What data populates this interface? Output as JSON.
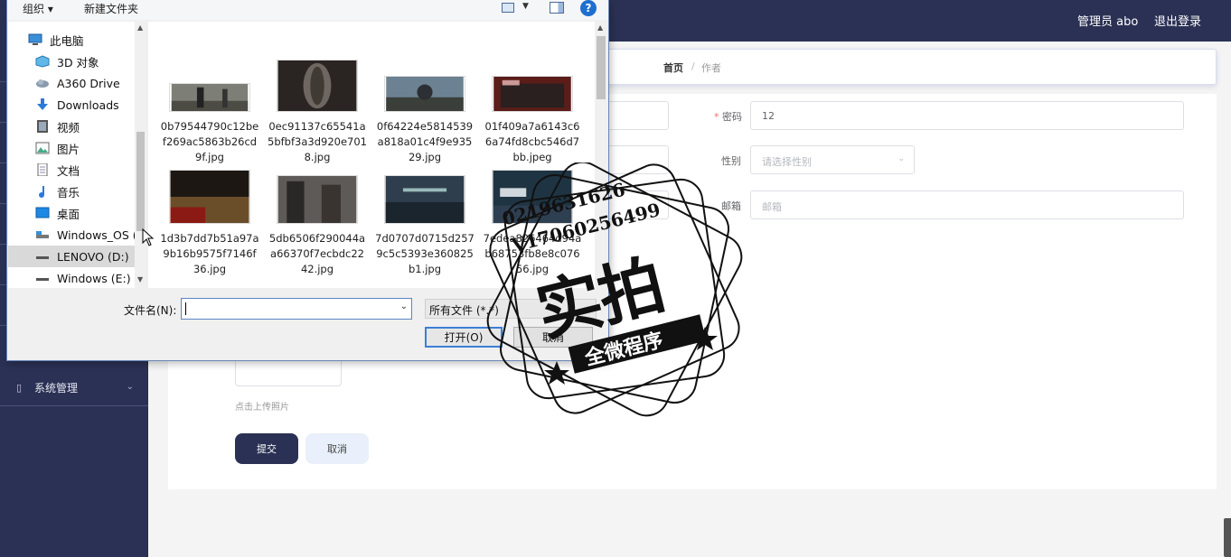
{
  "topbar": {
    "user": "管理员 abo",
    "logout": "退出登录"
  },
  "breadcrumb": {
    "home": "首页",
    "separator": "/",
    "current": "作者"
  },
  "sidebar": {
    "items": [
      {
        "label": "系统管理",
        "icon": "phone-icon"
      }
    ]
  },
  "form": {
    "password": {
      "label": "密码",
      "required_mark": "*",
      "value": "12"
    },
    "gender": {
      "label": "性别",
      "placeholder": "请选择性别"
    },
    "email": {
      "label": "邮箱",
      "placeholder": "邮箱"
    },
    "upload_hint": "点击上传照片",
    "submit": "提交",
    "cancel": "取消"
  },
  "dialog": {
    "toolbar": {
      "organize": "组织 ▾",
      "new_folder": "新建文件夹",
      "help": "?"
    },
    "nav_items": [
      {
        "label": "此电脑",
        "icon": "computer-icon"
      },
      {
        "label": "3D 对象",
        "icon": "cube-icon"
      },
      {
        "label": "A360 Drive",
        "icon": "cloud-drive-icon"
      },
      {
        "label": "Downloads",
        "icon": "download-arrow-icon"
      },
      {
        "label": "视频",
        "icon": "film-icon"
      },
      {
        "label": "图片",
        "icon": "picture-icon"
      },
      {
        "label": "文档",
        "icon": "document-icon"
      },
      {
        "label": "音乐",
        "icon": "music-note-icon"
      },
      {
        "label": "桌面",
        "icon": "desktop-icon"
      },
      {
        "label": "Windows_OS (C",
        "icon": "drive-icon"
      },
      {
        "label": "LENOVO (D:)",
        "icon": "drive-icon",
        "selected": true
      },
      {
        "label": "Windows (E:)",
        "icon": "drive-icon"
      }
    ],
    "files": [
      {
        "name": "0b79544790c12bef269ac5863b26cd9f.jpg"
      },
      {
        "name": "0ec91137c65541a5bfbf3a3d920e7018.jpg"
      },
      {
        "name": "0f64224e5814539a818a01c4f9e93529.jpg"
      },
      {
        "name": "01f409a7a6143c66a74fd8cbc546d7bb.jpeg"
      },
      {
        "name": "1d3b7dd7b51a97a9b16b9575f7146f36.jpg"
      },
      {
        "name": "5db6506f290044aa66370f7ecbdc2242.jpg"
      },
      {
        "name": "7d0707d0715d2579c5c5393e360825b1.jpg"
      },
      {
        "name": "7edea826464d94ab68753fb8e8c07656.jpg"
      }
    ],
    "filename_label": "文件名(N):",
    "filename_value": "",
    "filetype": "所有文件 (*.*)",
    "open_button": "打开(O)",
    "cancel_button": "取消"
  },
  "watermark": {
    "line1": "0219631626",
    "line2": "V17060256499",
    "main": "实拍",
    "sub": "全微程序"
  }
}
